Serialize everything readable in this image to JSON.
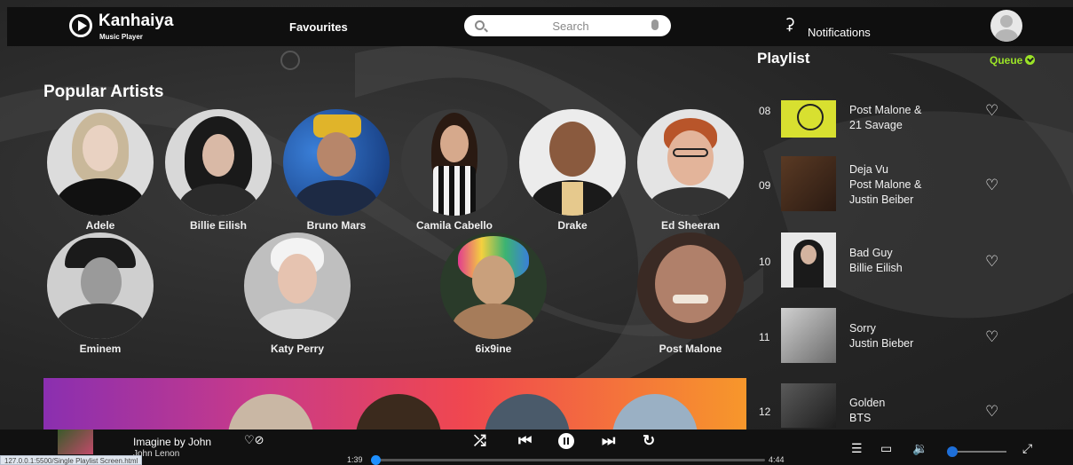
{
  "header": {
    "app_title": "Kanhaiya",
    "app_subtitle": "Music Player",
    "favourites_label": "Favourites",
    "search_placeholder": "Search",
    "notifications_label": "Notifications"
  },
  "artists_section": {
    "title": "Popular Artists",
    "artists": [
      {
        "name": "Adele"
      },
      {
        "name": "Billie Eilish"
      },
      {
        "name": "Bruno Mars"
      },
      {
        "name": "Camila Cabello"
      },
      {
        "name": "Drake"
      },
      {
        "name": "Ed Sheeran"
      },
      {
        "name": "Eminem"
      },
      {
        "name": "Katy Perry"
      },
      {
        "name": "6ix9ine"
      },
      {
        "name": "Post Malone"
      }
    ]
  },
  "playlist": {
    "title": "Playlist",
    "queue_label": "Queue",
    "tracks": [
      {
        "num": "08",
        "line1": "Post Malone &",
        "line2": "21 Savage",
        "line3": ""
      },
      {
        "num": "09",
        "line1": "Deja Vu",
        "line2": "Post Malone &",
        "line3": "Justin Beiber"
      },
      {
        "num": "10",
        "line1": "Bad Guy",
        "line2": "Billie Eilish",
        "line3": ""
      },
      {
        "num": "11",
        "line1": "Sorry",
        "line2": "Justin Bieber",
        "line3": ""
      },
      {
        "num": "12",
        "line1": "Golden",
        "line2": "BTS",
        "line3": ""
      }
    ]
  },
  "player": {
    "track_title": "Imagine by John",
    "track_artist": "John Lenon",
    "elapsed": "1:39",
    "duration": "4:44",
    "progress_fraction": 0.0,
    "volume_fraction": 0.0
  },
  "status_url": "127.0.0.1:5500/Single Playlist Screen.html",
  "colors": {
    "accent_queue": "#9be327",
    "seek_knob": "#1e90ff",
    "banner_gradient": [
      "#8a2fb0",
      "#c83a8a",
      "#f0474f",
      "#f7972b"
    ]
  }
}
